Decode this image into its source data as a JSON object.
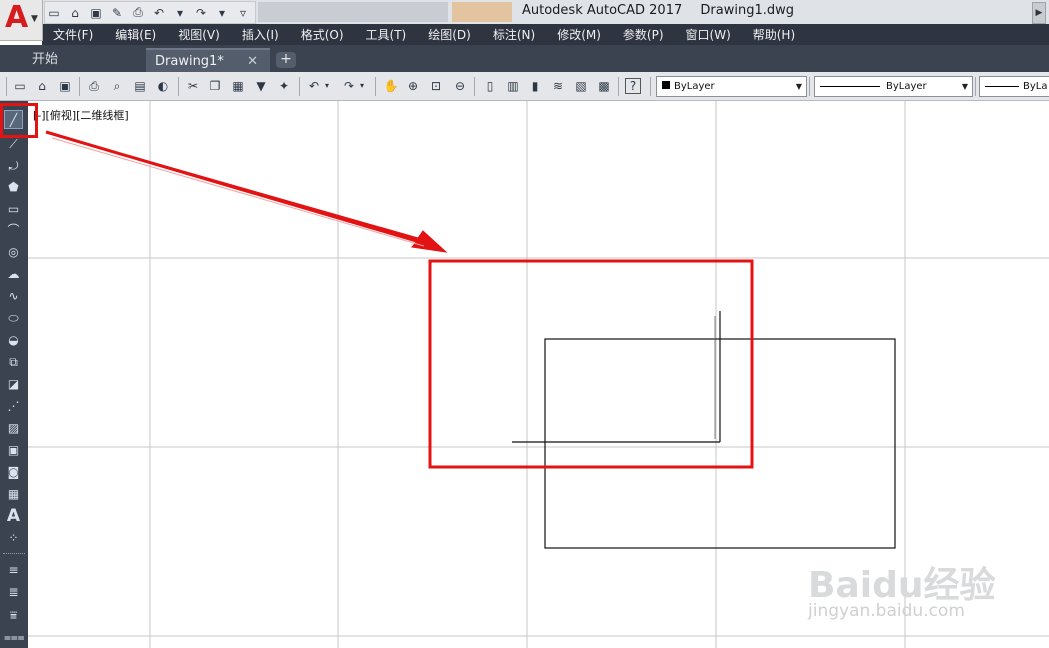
{
  "app": {
    "logo_letter": "A",
    "title": "Autodesk AutoCAD 2017",
    "document": "Drawing1.dwg"
  },
  "menu": [
    "文件(F)",
    "编辑(E)",
    "视图(V)",
    "插入(I)",
    "格式(O)",
    "工具(T)",
    "绘图(D)",
    "标注(N)",
    "修改(M)",
    "参数(P)",
    "窗口(W)",
    "帮助(H)"
  ],
  "tabs": {
    "start": "开始",
    "drawing": "Drawing1*",
    "close_glyph": "✕",
    "add_glyph": "+"
  },
  "properties": {
    "color": "ByLayer",
    "linetype": "ByLayer",
    "lineweight": "ByLa"
  },
  "viewport": {
    "label": "[-][俯视][二维线框]"
  },
  "watermark": {
    "brand": "Baidu经验",
    "url": "jingyan.baidu.com"
  },
  "colors": {
    "highlight": "#e31313",
    "menubar": "#2e3440",
    "tool_panel": "#3b4350"
  },
  "icons": {
    "left_tools": [
      "line-icon",
      "construction-line-icon",
      "polyline-icon",
      "polygon-icon",
      "rectangle-icon",
      "arc-icon",
      "circle-icon",
      "revision-cloud-icon",
      "spline-icon",
      "ellipse-icon",
      "ellipse-arc-icon",
      "insert-block-icon",
      "make-block-icon",
      "point-icon",
      "hatch-icon",
      "gradient-icon",
      "region-icon",
      "table-icon",
      "multiline-text-icon",
      "add-selected-icon",
      "layer-icon",
      "layer-states-icon",
      "layer-match-icon",
      "layer-iso-icon"
    ]
  }
}
